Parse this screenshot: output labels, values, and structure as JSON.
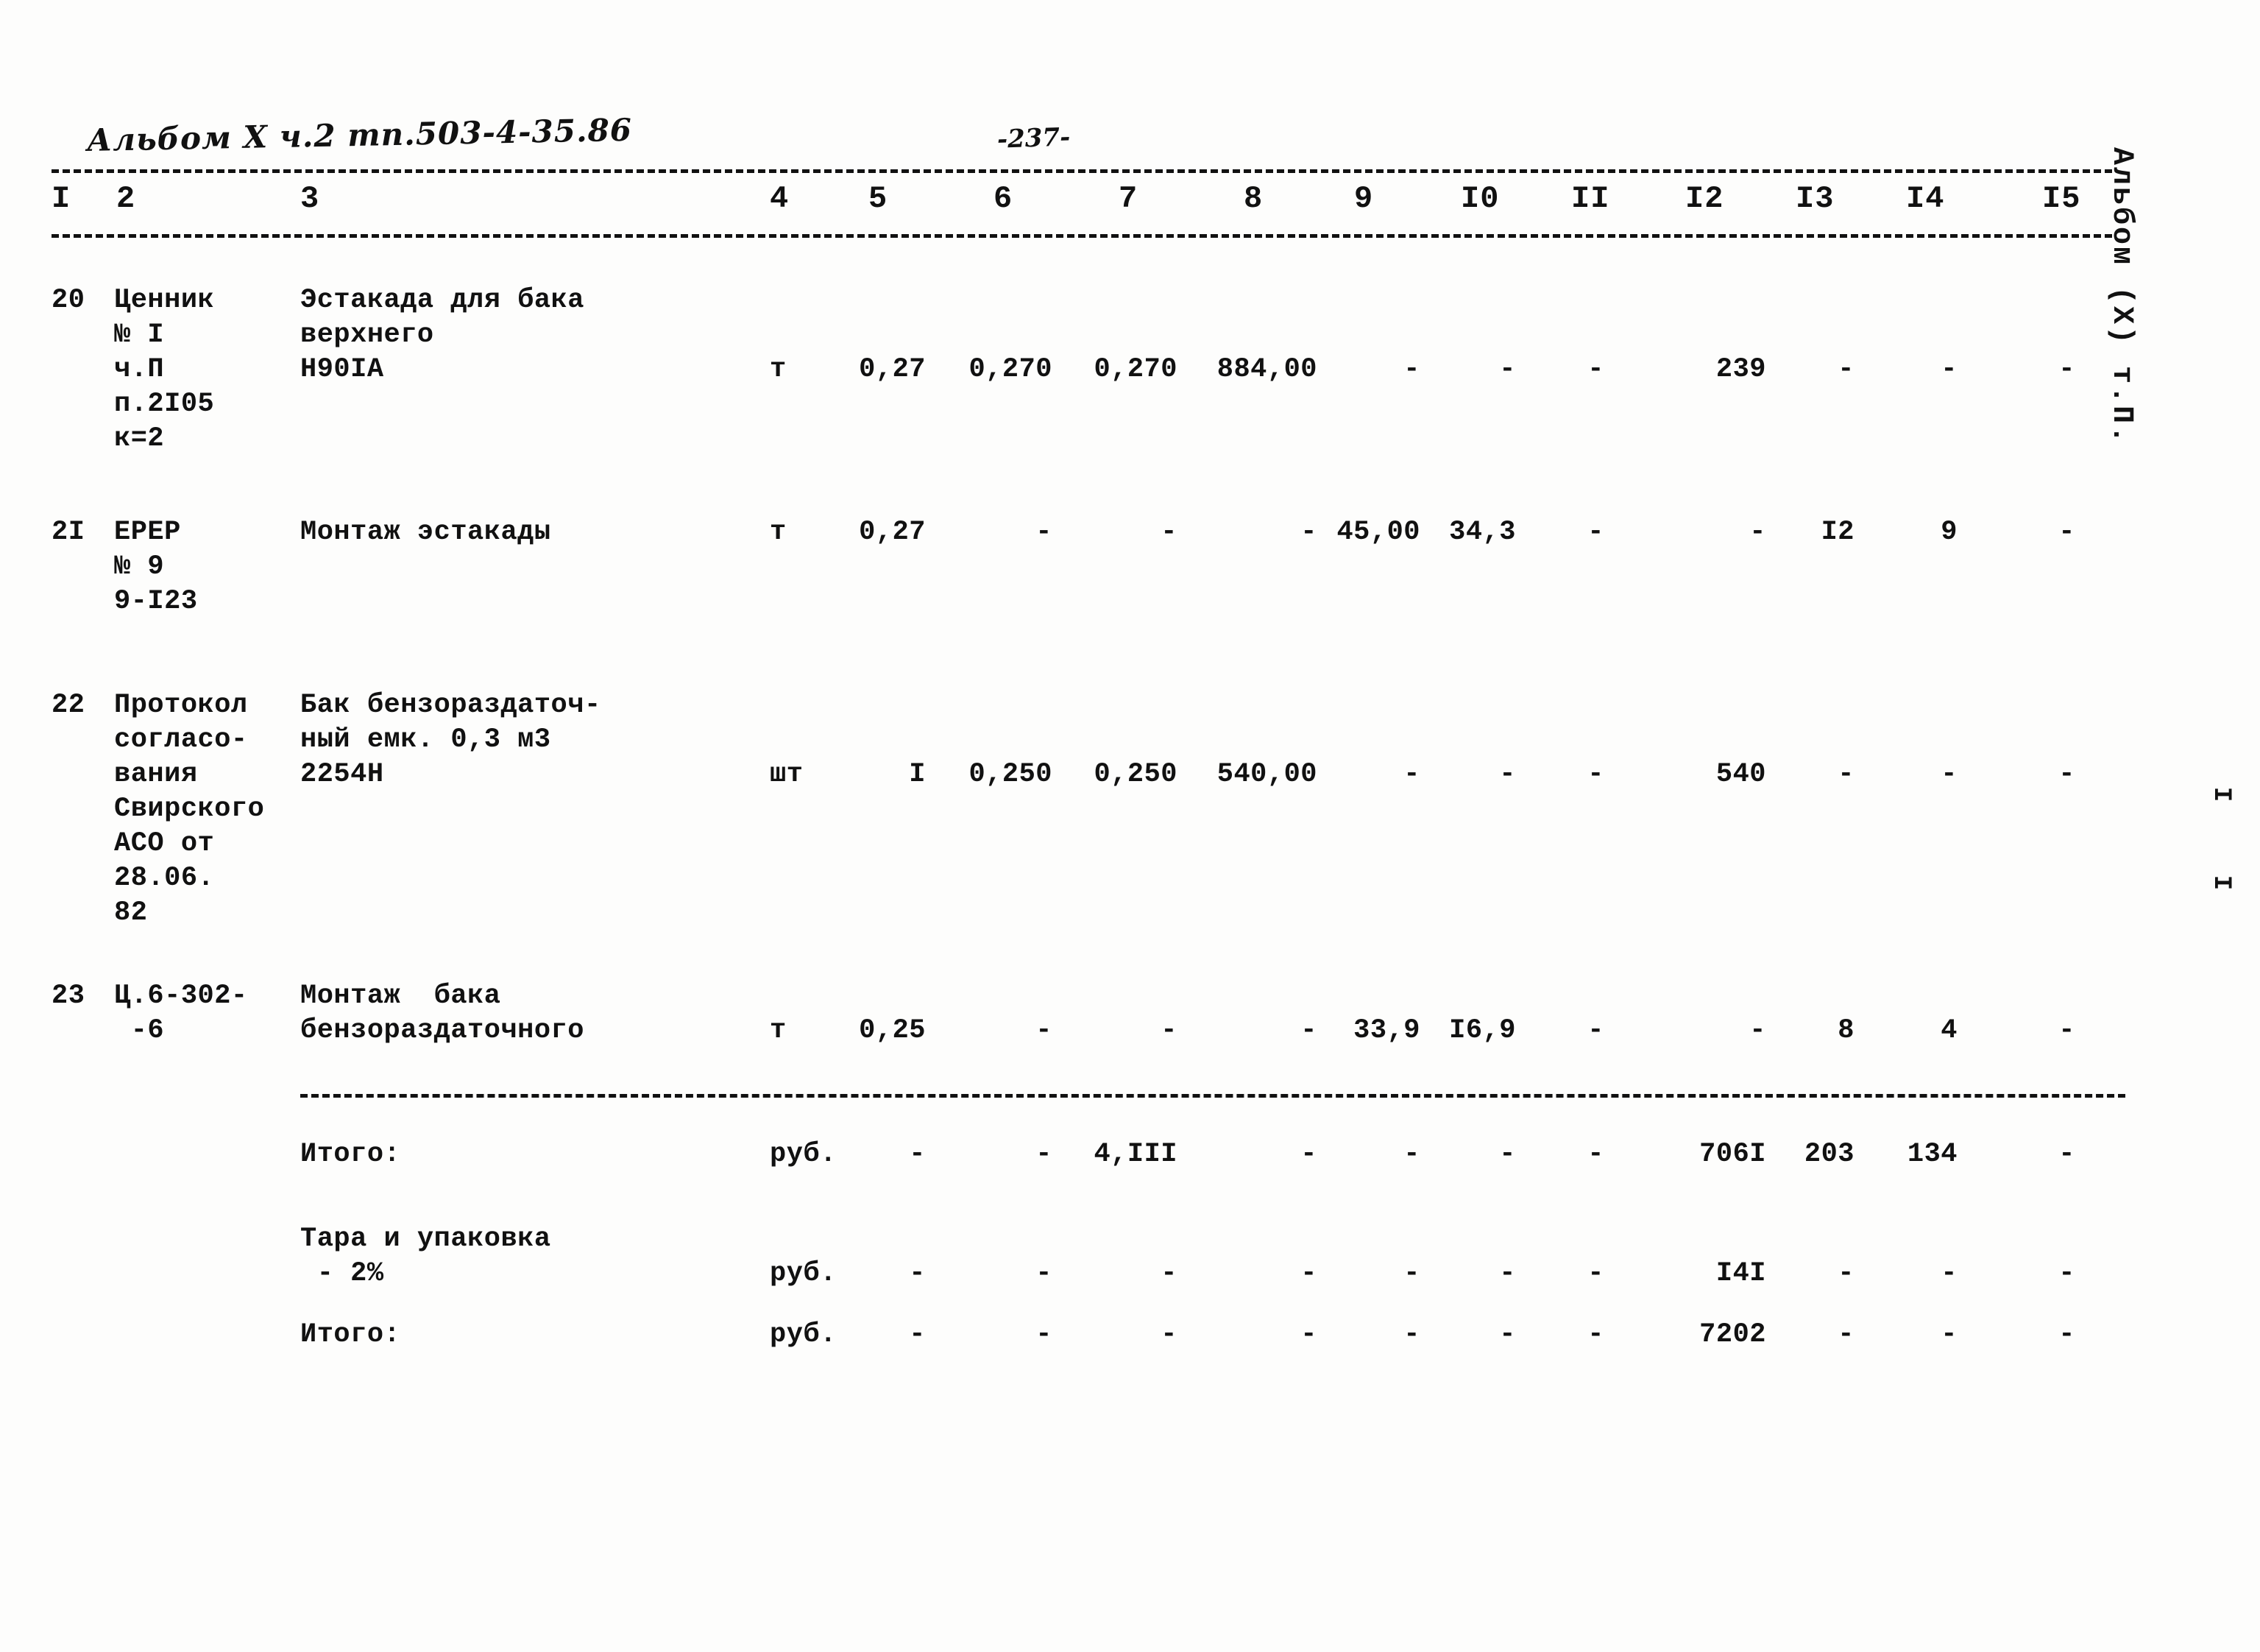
{
  "document": {
    "header_handwritten": "Альбом X ч.2 тп.503-4-35.86",
    "page_number": "-237-",
    "margin_note": "Альбом (X) т.П.",
    "margin_tick_1": "I",
    "margin_tick_2": "I"
  },
  "table": {
    "column_headers": [
      "I",
      "2",
      "3",
      "4",
      "5",
      "6",
      "7",
      "8",
      "9",
      "I0",
      "II",
      "I2",
      "I3",
      "I4",
      "I5"
    ],
    "rows": [
      {
        "no": "20",
        "code_lines": [
          "Ценник",
          "№ I",
          "ч.П",
          "п.2I05",
          "к=2"
        ],
        "name_lines": [
          "Эстакада для бака",
          "верхнего",
          "H90IA"
        ],
        "unit": "т",
        "c5": "0,27",
        "c6": "0,270",
        "c7": "0,270",
        "c8": "884,00",
        "c9": "-",
        "c10": "-",
        "c11": "-",
        "c12": "239",
        "c13": "-",
        "c14": "-",
        "c15": "-"
      },
      {
        "no": "2I",
        "code_lines": [
          "ЕРЕР",
          "№ 9",
          "9-I23"
        ],
        "name_lines": [
          "Монтаж эстакады"
        ],
        "unit": "т",
        "c5": "0,27",
        "c6": "-",
        "c7": "-",
        "c8": "-",
        "c9": "45,00",
        "c10": "34,3",
        "c11": "-",
        "c12": "-",
        "c13": "I2",
        "c14": "9",
        "c15": "-"
      },
      {
        "no": "22",
        "code_lines": [
          "Протокол",
          "согласо-",
          "вания",
          "Свирского",
          "АСО от",
          "28.06.",
          "82"
        ],
        "name_lines": [
          "Бак бензораздаточ-",
          "ный емк. 0,3 м3",
          "2254Н"
        ],
        "unit": "шт",
        "c5": "I",
        "c6": "0,250",
        "c7": "0,250",
        "c8": "540,00",
        "c9": "-",
        "c10": "-",
        "c11": "-",
        "c12": "540",
        "c13": "-",
        "c14": "-",
        "c15": "-"
      },
      {
        "no": "23",
        "code_lines": [
          "Ц.6-302-",
          " -6"
        ],
        "name_lines": [
          "Монтаж  бака",
          "бензораздаточного"
        ],
        "unit": "т",
        "c5": "0,25",
        "c6": "-",
        "c7": "-",
        "c8": "-",
        "c9": "33,9",
        "c10": "I6,9",
        "c11": "-",
        "c12": "-",
        "c13": "8",
        "c14": "4",
        "c15": "-"
      }
    ],
    "summary_rows": [
      {
        "label_lines": [
          "Итого:"
        ],
        "unit": "руб.",
        "c5": "-",
        "c6": "-",
        "c7": "4,III",
        "c8": "-",
        "c9": "-",
        "c10": "-",
        "c11": "-",
        "c12": "706I",
        "c13": "203",
        "c14": "134",
        "c15": "-"
      },
      {
        "label_lines": [
          "Тара и упаковка",
          " - 2%"
        ],
        "unit": "руб.",
        "c5": "-",
        "c6": "-",
        "c7": "-",
        "c8": "-",
        "c9": "-",
        "c10": "-",
        "c11": "-",
        "c12": "I4I",
        "c13": "-",
        "c14": "-",
        "c15": "-"
      },
      {
        "label_lines": [
          "Итого:"
        ],
        "unit": "руб.",
        "c5": "-",
        "c6": "-",
        "c7": "-",
        "c8": "-",
        "c9": "-",
        "c10": "-",
        "c11": "-",
        "c12": "7202",
        "c13": "-",
        "c14": "-",
        "c15": "-"
      }
    ]
  }
}
